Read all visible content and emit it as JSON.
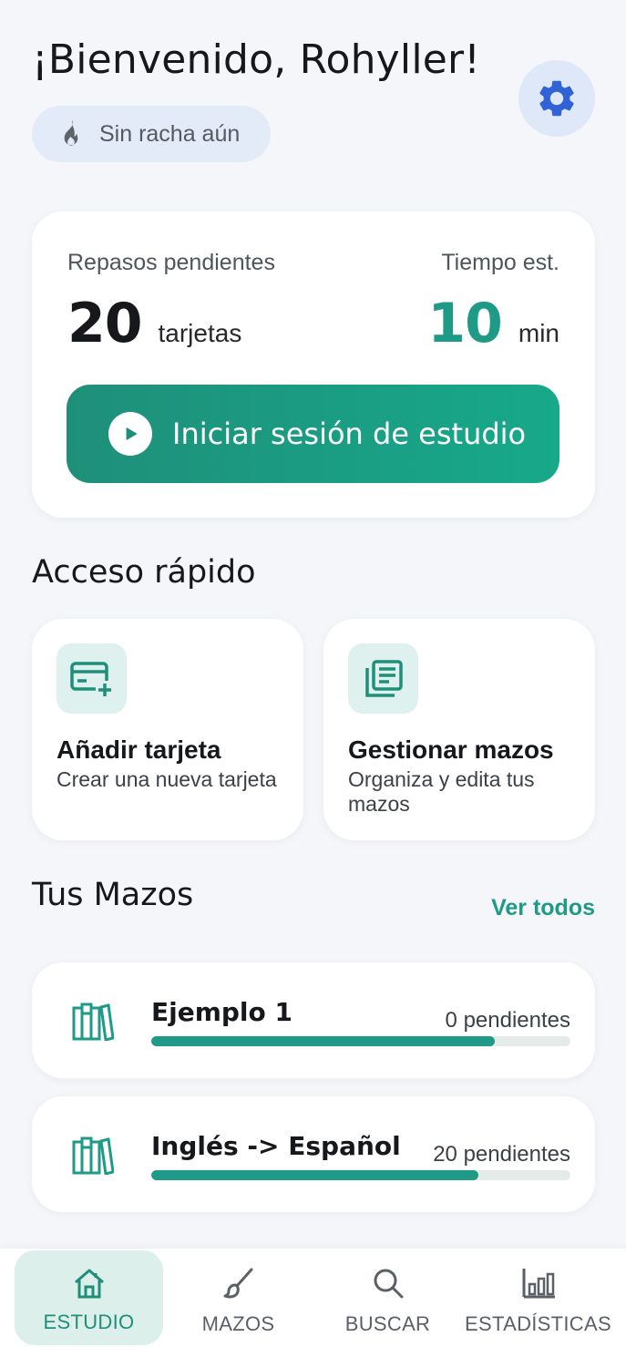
{
  "header": {
    "greeting": "¡Bienvenido, Rohyller!",
    "streak_label": "Sin racha aún",
    "settings_icon": "gear-icon",
    "streak_icon": "flame-icon"
  },
  "summary": {
    "pending_label": "Repasos pendientes",
    "pending_count": "20",
    "pending_unit": "tarjetas",
    "time_label": "Tiempo est.",
    "time_value": "10",
    "time_unit": "min",
    "start_button_label": "Iniciar sesión de estudio"
  },
  "quick_access": {
    "title": "Acceso rápido",
    "items": [
      {
        "name": "Añadir tarjeta",
        "description": "Crear una nueva tarjeta",
        "icon": "add-card-icon"
      },
      {
        "name": "Gestionar mazos",
        "description": "Organiza y edita tus mazos",
        "icon": "decks-icon"
      }
    ]
  },
  "decks": {
    "title": "Tus Mazos",
    "see_all": "Ver todos",
    "items": [
      {
        "name": "Ejemplo 1",
        "pending": "0 pendientes",
        "progress": 0.82,
        "icon": "books-icon"
      },
      {
        "name": "Inglés -> Español",
        "pending": "20 pendientes",
        "progress": 0.78,
        "icon": "books-icon"
      }
    ]
  },
  "nav": {
    "items": [
      {
        "label": "ESTUDIO",
        "icon": "home-icon",
        "active": true
      },
      {
        "label": "MAZOS",
        "icon": "brush-icon",
        "active": false
      },
      {
        "label": "BUSCAR",
        "icon": "search-icon",
        "active": false
      },
      {
        "label": "ESTADÍSTICAS",
        "icon": "bar-chart-icon",
        "active": false
      }
    ]
  },
  "colors": {
    "accent": "#1f9a86",
    "accent_light": "#dcefeb",
    "background": "#f4f6f9"
  }
}
